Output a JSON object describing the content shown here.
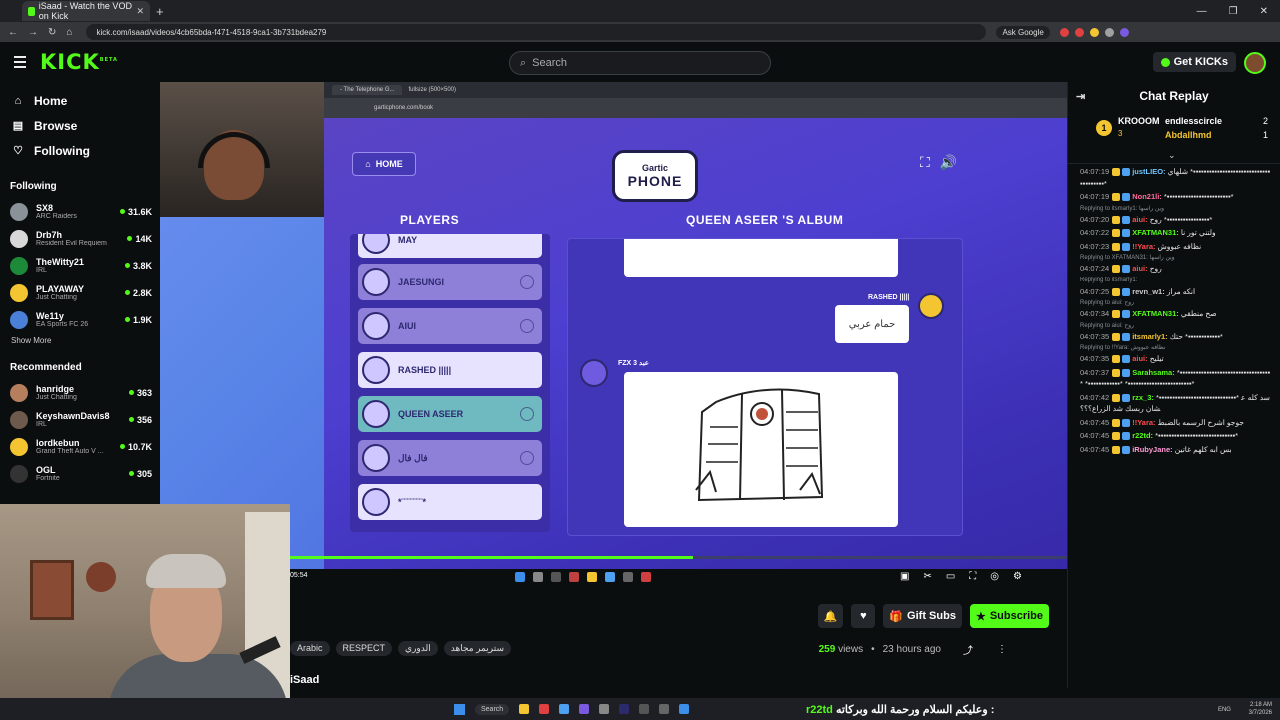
{
  "browser": {
    "tab_title": "iSaad - Watch the VOD on Kick",
    "url": "kick.com/isaad/videos/4cb65bda-f471-4518-9ca1-3b731bdea279",
    "ask_google": "Ask Google"
  },
  "header": {
    "logo": "KICK",
    "logo_sup": "BETA",
    "search_placeholder": "Search",
    "get_kicks": "Get KICKs"
  },
  "sidebar": {
    "nav": [
      {
        "label": "Home",
        "icon": "home-icon"
      },
      {
        "label": "Browse",
        "icon": "browse-icon"
      },
      {
        "label": "Following",
        "icon": "heart-icon"
      }
    ],
    "following_title": "Following",
    "following": [
      {
        "name": "SX8",
        "game": "ARC Raiders",
        "viewers": "31.6K",
        "color": "#8a9199"
      },
      {
        "name": "Drb7h",
        "game": "Resident Evil Requiem",
        "viewers": "14K",
        "color": "#d8d8d8"
      },
      {
        "name": "TheWitty21",
        "game": "IRL",
        "viewers": "3.8K",
        "color": "#1d8a3a"
      },
      {
        "name": "PLAYAWAY",
        "game": "Just Chatting",
        "viewers": "2.8K",
        "color": "#f3c530"
      },
      {
        "name": "We11y",
        "game": "EA Sports FC 26",
        "viewers": "1.9K",
        "color": "#4a80d8"
      }
    ],
    "show_more": "Show More",
    "recommended_title": "Recommended",
    "recommended": [
      {
        "name": "hanridge",
        "game": "Just Chatting",
        "viewers": "363",
        "color": "#b57f5e"
      },
      {
        "name": "KeyshawnDavis8",
        "game": "IRL",
        "viewers": "356",
        "color": "#6e5a4c"
      },
      {
        "name": "lordkebun",
        "game": "Grand Theft Auto V ...",
        "viewers": "10.7K",
        "color": "#f3c530"
      },
      {
        "name": "OGL",
        "game": "Fortnite",
        "viewers": "305",
        "color": "#333"
      }
    ]
  },
  "video": {
    "inner_tab1": "- The Telephone G...",
    "inner_tab2": "fullsize (500×500)",
    "inner_url": "garticphone.com/book",
    "home_label": "HOME",
    "logo_top": "Gartic",
    "logo_bottom": "PHONE",
    "players_title": "PLAYERS",
    "album_title": "QUEEN ASEER 'S ALBUM",
    "players": [
      {
        "name": "MAY",
        "style": "white"
      },
      {
        "name": "JAESUNGI",
        "style": "normal"
      },
      {
        "name": "AIUI",
        "style": "normal"
      },
      {
        "name": "RASHED |||||",
        "style": "white"
      },
      {
        "name": "QUEEN ASEER",
        "style": "teal"
      },
      {
        "name": "فال فال",
        "style": "normal"
      },
      {
        "name": "*¨¨¨¨¨¨¨*",
        "style": "white"
      }
    ],
    "rashed_name": "RASHED |||||",
    "rashed_text": "حمام عربي",
    "fzx_name": "FZX 3 عبد",
    "timecode": "05:54",
    "progress": 0.52
  },
  "info": {
    "gift_subs": "Gift Subs",
    "subscribe": "Subscribe",
    "tags": [
      "Arabic",
      "RESPECT",
      "الدوري",
      "ستريمر مجاهد"
    ],
    "views_count": "259",
    "views_label": "views",
    "ago": "23 hours ago",
    "name": "iSaad"
  },
  "chat": {
    "title": "Chat Replay",
    "leader1": {
      "rank": "1",
      "name": "KROOOM",
      "count": "3"
    },
    "leader2": {
      "name": "endlesscircle",
      "count": "2"
    },
    "leader3": {
      "name": "Abdallhmd",
      "count": "1"
    },
    "messages": [
      {
        "reply": "",
        "time": "04:07:19",
        "user": "justLIEO:",
        "color": "#6ec6ff",
        "text": "شلهاي *▪▪▪▪▪▪▪▪▪▪▪▪▪▪▪▪▪▪▪▪▪▪▪▪▪▪▪▪▪▪▪▪▪▪▪▪▪▪*"
      },
      {
        "reply": "",
        "time": "04:07:19",
        "user": "Non21li:",
        "color": "#ff6b9a",
        "text": "*▪▪▪▪▪▪▪▪▪▪▪▪▪▪▪▪▪▪▪▪▪▪▪▪*"
      },
      {
        "reply": "Replying to itsmarly1: وين راسها",
        "time": "04:07:20",
        "user": "aiui:",
        "color": "#ff4d4d",
        "text": "روح *▪▪▪▪▪▪▪▪▪▪▪▪▪▪▪▪*"
      },
      {
        "reply": "",
        "time": "04:07:22",
        "user": "XFATMAN31:",
        "color": "#53fc18",
        "text": "ولتني تور نا"
      },
      {
        "reply": "",
        "time": "04:07:23",
        "user": "!!Yara:",
        "color": "#ff4d4d",
        "text": "نظافه عبووش"
      },
      {
        "reply": "Replying to XFATMAN31: وين راسها",
        "time": "04:07:24",
        "user": "aiui:",
        "color": "#ff4d4d",
        "text": "روح"
      },
      {
        "reply": "Replying to itsmarly1:",
        "time": "04:07:25",
        "user": "revn_w1:",
        "color": "#cccccc",
        "text": "انكه مراز"
      },
      {
        "reply": "Replying to aiui: روح",
        "time": "04:07:34",
        "user": "XFATMAN31:",
        "color": "#53fc18",
        "text": "صح منطقي"
      },
      {
        "reply": "Replying to aiui: روح",
        "time": "04:07:35",
        "user": "itsmarly1:",
        "color": "#f3c530",
        "text": "حتك *▪▪▪▪▪▪▪▪▪▪▪▪*"
      },
      {
        "reply": "Replying to !!Yara: نظافه عبووش",
        "time": "04:07:35",
        "user": "aiui:",
        "color": "#ff4d4d",
        "text": "تيليح"
      },
      {
        "reply": "",
        "time": "04:07:37",
        "user": "Sarahsama:",
        "color": "#53fc18",
        "text": "*▪▪▪▪▪▪▪▪▪▪▪▪▪▪▪▪▪▪▪▪▪▪▪▪▪▪▪▪▪▪▪▪▪▪* *▪▪▪▪▪▪▪▪▪▪▪▪* *▪▪▪▪▪▪▪▪▪▪▪▪▪▪▪▪▪▪▪▪▪▪▪▪*"
      },
      {
        "reply": "",
        "time": "04:07:42",
        "user": "rzx_3:",
        "color": "#53fc18",
        "text": "*▪▪▪▪▪▪▪▪▪▪▪▪▪▪▪▪▪▪▪▪▪▪▪▪▪▪▪▪▪* سد كله عشان ربسك شد الزراع؟؟؟"
      },
      {
        "reply": "",
        "time": "04:07:45",
        "user": "!!Yara:",
        "color": "#ff4d4d",
        "text": "جوجو اشرح الرسمه بالضبط"
      },
      {
        "reply": "",
        "time": "04:07:45",
        "user": "r22td:",
        "color": "#53fc18",
        "text": "*▪▪▪▪▪▪▪▪▪▪▪▪▪▪▪▪▪▪▪▪▪▪▪▪▪▪▪▪▪*"
      },
      {
        "reply": "",
        "time": "04:07:45",
        "user": "iRubyJane:",
        "color": "#ff9ad5",
        "text": "بس ابه كلهم غاتين"
      }
    ]
  },
  "taskbar": {
    "search": "Search",
    "marquee_user": "r22td",
    "marquee_text": "وعليكم السلام ورحمة الله وبركاته :",
    "time": "2:18 AM",
    "date": "3/7/2026",
    "lang": "ENG"
  }
}
